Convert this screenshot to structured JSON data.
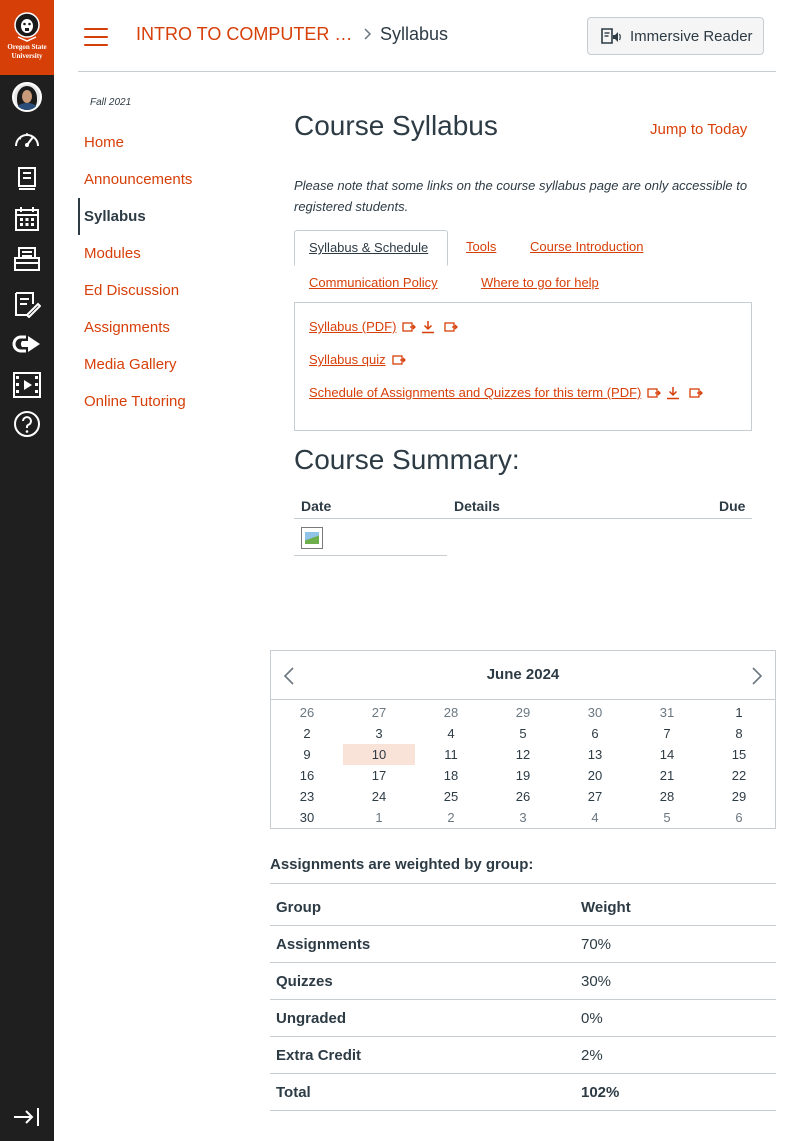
{
  "brand": {
    "logo_line1": "Oregon State",
    "logo_line2": "University",
    "accent": "#d73f09",
    "rail_bg": "#1f1f1f"
  },
  "rail": {
    "items": [
      "avatar",
      "dashboard-icon",
      "courses-icon",
      "calendar-icon",
      "inbox-icon",
      "history-icon",
      "commons-icon",
      "media-icon",
      "help-icon"
    ],
    "collapse_icon": "collapse-nav-icon"
  },
  "header": {
    "course_crumb": "INTRO TO COMPUTER S…",
    "current_crumb": "Syllabus",
    "immersive_reader": "Immersive Reader"
  },
  "course_nav": {
    "term": "Fall 2021",
    "items": [
      {
        "label": "Home"
      },
      {
        "label": "Announcements"
      },
      {
        "label": "Syllabus"
      },
      {
        "label": "Modules"
      },
      {
        "label": "Ed Discussion"
      },
      {
        "label": "Assignments"
      },
      {
        "label": "Media Gallery"
      },
      {
        "label": "Online Tutoring"
      }
    ]
  },
  "main": {
    "title": "Course Syllabus",
    "jump_to_today": "Jump to Today",
    "note": "Please note that some links on the course syllabus page are only accessible to registered students.",
    "tabs": [
      {
        "label": "Syllabus & Schedule"
      },
      {
        "label": "Tools"
      },
      {
        "label": "Course Introduction"
      },
      {
        "label": "Communication Policy"
      },
      {
        "label": "Where to go for help"
      }
    ],
    "links": [
      {
        "label": "Syllabus (PDF)"
      },
      {
        "label": "Syllabus quiz"
      },
      {
        "label": "Schedule of Assignments and Quizzes for this term (PDF)"
      }
    ],
    "summary_title": "Course Summary:",
    "summary_headers": {
      "date": "Date",
      "details": "Details",
      "due": "Due"
    }
  },
  "calendar": {
    "title": "June 2024",
    "today": "10",
    "weeks": [
      [
        {
          "d": "26",
          "o": true
        },
        {
          "d": "27",
          "o": true
        },
        {
          "d": "28",
          "o": true
        },
        {
          "d": "29",
          "o": true
        },
        {
          "d": "30",
          "o": true
        },
        {
          "d": "31",
          "o": true
        },
        {
          "d": "1"
        }
      ],
      [
        {
          "d": "2"
        },
        {
          "d": "3"
        },
        {
          "d": "4"
        },
        {
          "d": "5"
        },
        {
          "d": "6"
        },
        {
          "d": "7"
        },
        {
          "d": "8"
        }
      ],
      [
        {
          "d": "9"
        },
        {
          "d": "10"
        },
        {
          "d": "11"
        },
        {
          "d": "12"
        },
        {
          "d": "13"
        },
        {
          "d": "14"
        },
        {
          "d": "15"
        }
      ],
      [
        {
          "d": "16"
        },
        {
          "d": "17"
        },
        {
          "d": "18"
        },
        {
          "d": "19"
        },
        {
          "d": "20"
        },
        {
          "d": "21"
        },
        {
          "d": "22"
        }
      ],
      [
        {
          "d": "23"
        },
        {
          "d": "24"
        },
        {
          "d": "25"
        },
        {
          "d": "26"
        },
        {
          "d": "27"
        },
        {
          "d": "28"
        },
        {
          "d": "29"
        }
      ],
      [
        {
          "d": "30"
        },
        {
          "d": "1",
          "o": true
        },
        {
          "d": "2",
          "o": true
        },
        {
          "d": "3",
          "o": true
        },
        {
          "d": "4",
          "o": true
        },
        {
          "d": "5",
          "o": true
        },
        {
          "d": "6",
          "o": true
        }
      ]
    ]
  },
  "weights": {
    "title": "Assignments are weighted by group:",
    "headers": {
      "group": "Group",
      "weight": "Weight"
    },
    "rows": [
      {
        "group": "Assignments",
        "weight": "70%"
      },
      {
        "group": "Quizzes",
        "weight": "30%"
      },
      {
        "group": "Ungraded",
        "weight": "0%"
      },
      {
        "group": "Extra Credit",
        "weight": "2%"
      },
      {
        "group": "Total",
        "weight": "102%"
      }
    ]
  }
}
